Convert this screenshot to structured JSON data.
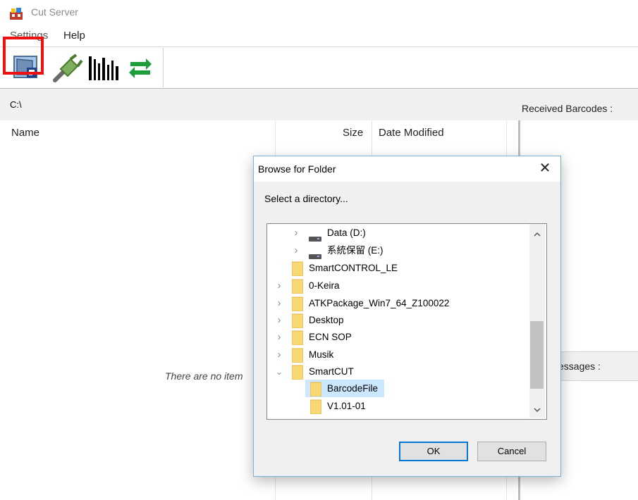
{
  "window": {
    "title": "Cut Server"
  },
  "menu": {
    "items": [
      "Settings",
      "Help"
    ]
  },
  "toolbar": {
    "buttons": [
      {
        "name": "open-folder",
        "icon": "folder-scan-icon"
      },
      {
        "name": "connect",
        "icon": "plug-icon"
      },
      {
        "name": "barcode",
        "icon": "barcode-icon"
      },
      {
        "name": "refresh",
        "icon": "refresh-arrows-icon"
      }
    ],
    "highlight_color": "#e11"
  },
  "path": {
    "current": "C:\\"
  },
  "file_list": {
    "columns": [
      "Name",
      "Size",
      "Date Modified"
    ],
    "empty_message": "There are no item"
  },
  "panels": {
    "received_label": "Received Barcodes :",
    "messages_label": "essages :"
  },
  "dialog": {
    "title": "Browse for Folder",
    "close_label": "✕",
    "subtitle": "Select a directory...",
    "tree": [
      {
        "label": "Data (D:)",
        "type": "drive",
        "expand": "collapsed"
      },
      {
        "label": "系統保留 (E:)",
        "type": "drive",
        "expand": "collapsed"
      },
      {
        "label": "SmartCONTROL_LE",
        "type": "folder",
        "expand": "none"
      },
      {
        "label": "0-Keira",
        "type": "folder",
        "expand": "collapsed"
      },
      {
        "label": "ATKPackage_Win7_64_Z100022",
        "type": "folder",
        "expand": "collapsed"
      },
      {
        "label": "Desktop",
        "type": "folder",
        "expand": "collapsed"
      },
      {
        "label": "ECN SOP",
        "type": "folder",
        "expand": "collapsed"
      },
      {
        "label": "Musik",
        "type": "folder",
        "expand": "collapsed"
      },
      {
        "label": "SmartCUT",
        "type": "folder",
        "expand": "expanded"
      },
      {
        "label": "BarcodeFile",
        "type": "folder",
        "expand": "none",
        "selected": true
      },
      {
        "label": "V1.01-01",
        "type": "folder",
        "expand": "none"
      }
    ],
    "ok_label": "OK",
    "cancel_label": "Cancel",
    "accent_color": "#0078d7",
    "selection_color": "#cce8ff"
  }
}
